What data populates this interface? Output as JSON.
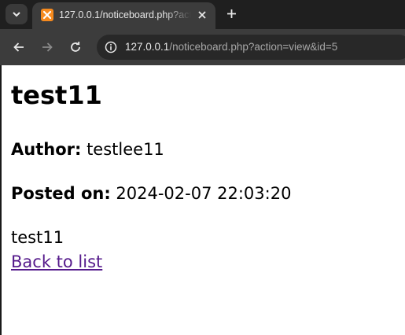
{
  "browser": {
    "tab": {
      "title": "127.0.0.1/noticeboard.php?action=view&id=5",
      "favicon": "xampp-favicon-icon"
    },
    "omnibox": {
      "url_host": "127.0.0.1",
      "url_path": "/noticeboard.php?action=view&id=5"
    },
    "icons": {
      "tab_search": "chevron-down-icon",
      "close_tab": "close-icon",
      "new_tab": "plus-icon",
      "back": "arrow-left-icon",
      "forward": "arrow-right-icon",
      "reload": "reload-icon",
      "site_info": "info-icon"
    },
    "colors": {
      "tabstrip": "#1f1f1f",
      "toolbar": "#3c3c3c",
      "omnibox": "#282828",
      "favicon": "#f68a1e"
    }
  },
  "page": {
    "title": "test11",
    "author_label": "Author:",
    "author_value": "testlee11",
    "posted_label": "Posted on:",
    "posted_value": "2024-02-07 22:03:20",
    "body": "test11",
    "back_link": "Back to list",
    "colors": {
      "text": "#000000",
      "visited_link": "#551a8b"
    }
  }
}
